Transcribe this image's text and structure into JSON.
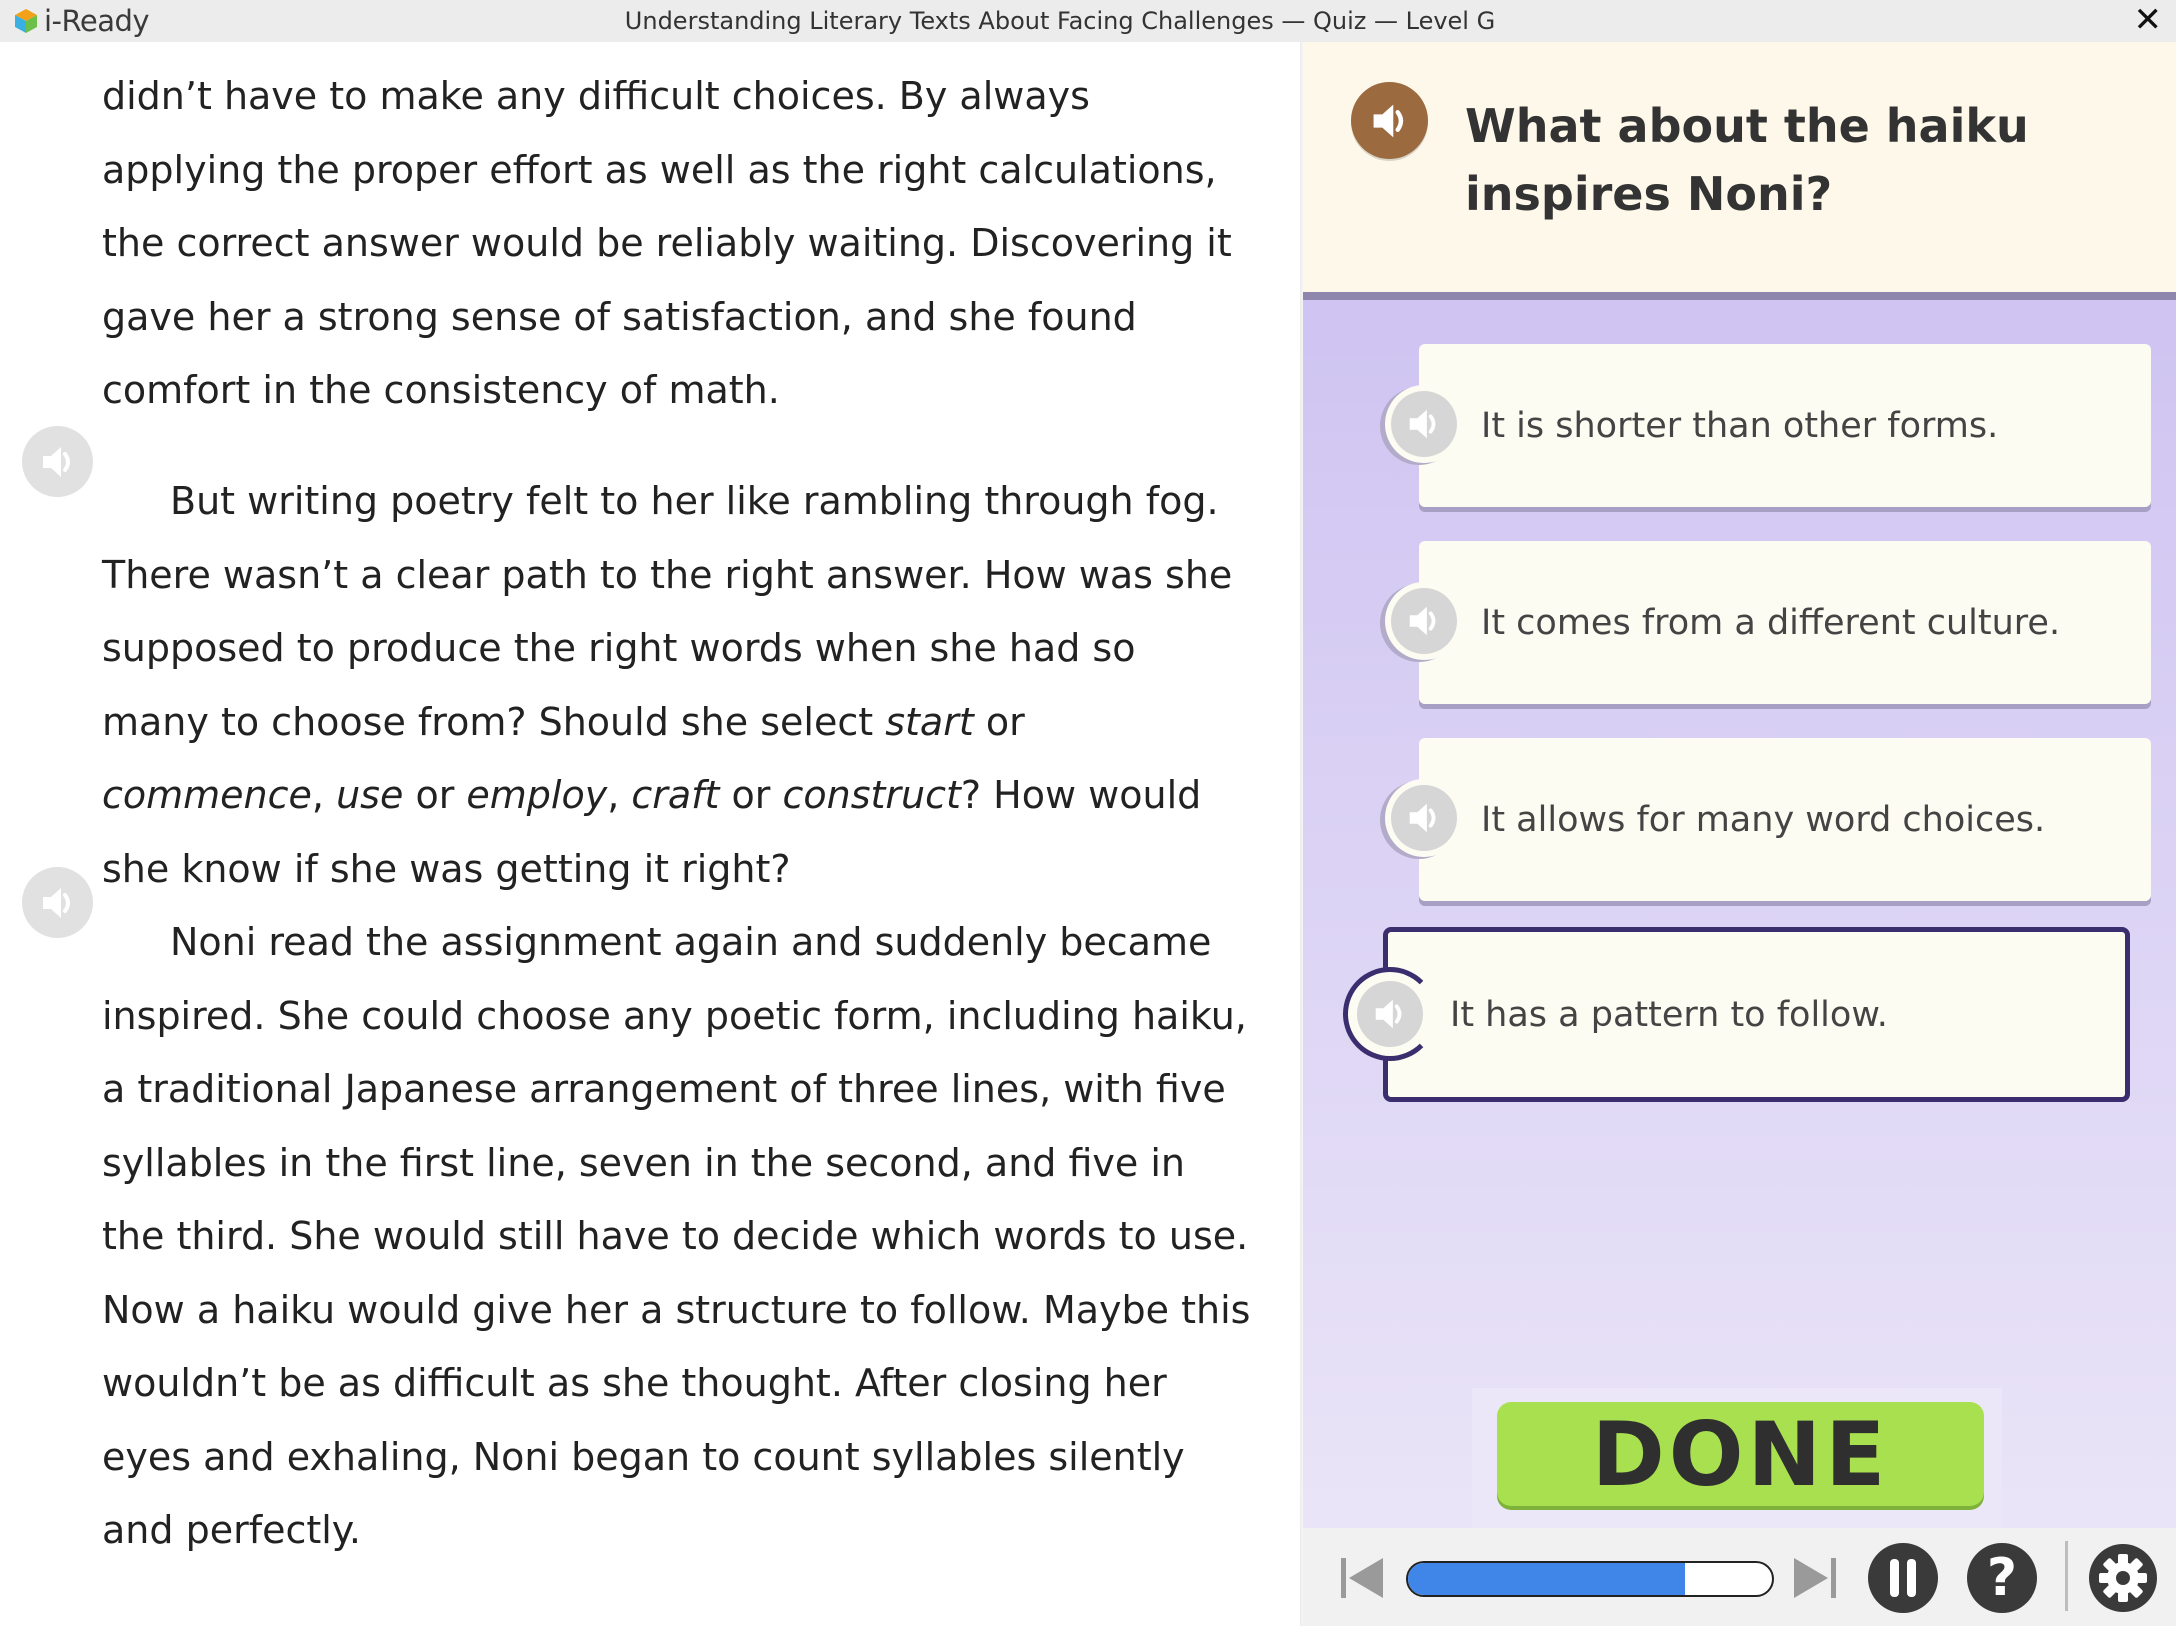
{
  "app": {
    "logo_text": "i-Ready",
    "window_title": "Understanding Literary Texts About Facing Challenges — Quiz — Level G",
    "close_glyph": "✕"
  },
  "passage": {
    "p1": "didn’t have to make any difficult choices.  By always applying the proper effort as well as the right calculations, the correct answer would be reliably waiting. Discovering it gave her a strong sense of satisfaction, and she found comfort in the consistency of math.",
    "p2a": "But writing poetry felt to her like rambling through fog. There wasn’t a clear path to the right answer. How was she supposed to produce the right words when she had so many to choose from? Should she select ",
    "p2_w1": "start",
    "p2_or1": " or ",
    "p2_w2": "commence",
    "p2_c1": ", ",
    "p2_w3": "use",
    "p2_or2": " or ",
    "p2_w4": "employ",
    "p2_c2": ", ",
    "p2_w5": "craft",
    "p2_or3": " or ",
    "p2_w6": "construct",
    "p2b": "? How would she know if she was getting it right?",
    "p3": "Noni read the assignment again and suddenly became inspired. She could choose any poetic form, including haiku, a traditional Japanese arrangement of three lines, with five syllables in the first line, seven in the second, and five in the third. She would still have to decide which words to use. Now a haiku would give her a structure to follow. Maybe this wouldn’t be as difficult as she thought. After closing her eyes and exhaling, Noni began to count syllables silently and perfectly."
  },
  "question": {
    "text": "What about the haiku inspires Noni?",
    "choices": [
      {
        "label": "It is shorter than other forms."
      },
      {
        "label": "It comes from a different culture."
      },
      {
        "label": "It allows for many word choices."
      },
      {
        "label": "It has a pattern to follow."
      }
    ],
    "selected_index": 3
  },
  "done_label": "DONE",
  "toolbar": {
    "progress_fraction": 0.76,
    "help_glyph": "?"
  },
  "colors": {
    "question_audio": "#9b6a3f",
    "done": "#a8e04f",
    "progress": "#3f86e8",
    "selected_border": "#3a2e6e"
  },
  "icons": [
    "speaker-icon",
    "skip-back-icon",
    "skip-forward-icon",
    "pause-icon",
    "help-icon",
    "gear-icon",
    "close-icon"
  ]
}
